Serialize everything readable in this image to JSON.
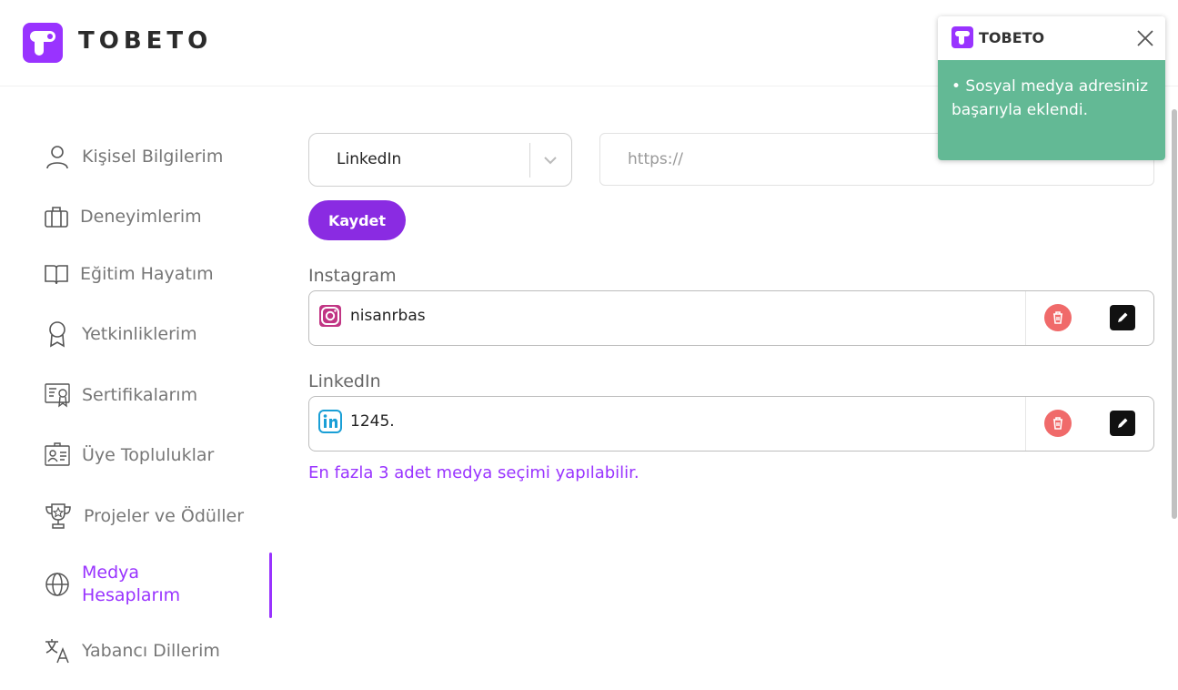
{
  "brand": {
    "name": "TOBETO",
    "color": "#9933ff"
  },
  "sidebar": {
    "items": [
      {
        "label": "Kişisel Bilgilerim",
        "icon": "user-icon"
      },
      {
        "label": "Deneyimlerim",
        "icon": "briefcase-icon"
      },
      {
        "label": "Eğitim Hayatım",
        "icon": "book-icon"
      },
      {
        "label": "Yetkinliklerim",
        "icon": "award-icon"
      },
      {
        "label": "Sertifikalarım",
        "icon": "certificate-icon"
      },
      {
        "label": "Üye Topluluklar",
        "icon": "id-card-icon"
      },
      {
        "label": "Projeler ve Ödüller",
        "icon": "trophy-icon"
      },
      {
        "label": "Medya\nHesaplarım",
        "icon": "globe-icon",
        "active": true
      },
      {
        "label": "Yabancı Dillerim",
        "icon": "translate-icon"
      }
    ]
  },
  "form": {
    "platform_selected": "LinkedIn",
    "url_placeholder": "https://",
    "url_value": "",
    "save_label": "Kaydet"
  },
  "media": [
    {
      "platform": "Instagram",
      "value": "nisanrbas",
      "icon": "instagram-icon"
    },
    {
      "platform": "LinkedIn",
      "value": "1245.",
      "icon": "linkedin-icon"
    }
  ],
  "limit_note": "En fazla 3 adet medya seçimi yapılabilir.",
  "toast": {
    "title": "TOBETO",
    "message": "• Sosyal medya adresiniz başarıyla eklendi.",
    "color": "#63b995"
  }
}
